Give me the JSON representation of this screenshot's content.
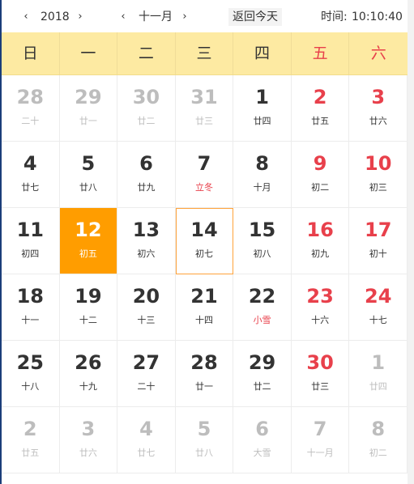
{
  "header": {
    "prev_year": "‹",
    "year": "2018",
    "next_year": "›",
    "prev_month": "‹",
    "month": "十一月",
    "next_month": "›",
    "today_label": "返回今天",
    "time_label": "时间:",
    "time_value": "10:10:40"
  },
  "weekdays": [
    "日",
    "一",
    "二",
    "三",
    "四",
    "五",
    "六"
  ],
  "colors": {
    "weekday_bar": "#fdeaa2",
    "weekend": "#e8404b",
    "today_bg": "#ff9d00",
    "selected_border": "#ffa33a",
    "other_month": "#bdbdbd"
  },
  "rows": [
    [
      {
        "day": "28",
        "lunar": "二十",
        "other": true
      },
      {
        "day": "29",
        "lunar": "廿一",
        "other": true
      },
      {
        "day": "30",
        "lunar": "廿二",
        "other": true
      },
      {
        "day": "31",
        "lunar": "廿三",
        "other": true
      },
      {
        "day": "1",
        "lunar": "廿四"
      },
      {
        "day": "2",
        "lunar": "廿五",
        "weekend": true
      },
      {
        "day": "3",
        "lunar": "廿六",
        "weekend": true
      }
    ],
    [
      {
        "day": "4",
        "lunar": "廿七"
      },
      {
        "day": "5",
        "lunar": "廿八"
      },
      {
        "day": "6",
        "lunar": "廿九"
      },
      {
        "day": "7",
        "lunar": "立冬",
        "term": true
      },
      {
        "day": "8",
        "lunar": "十月"
      },
      {
        "day": "9",
        "lunar": "初二",
        "weekend": true
      },
      {
        "day": "10",
        "lunar": "初三",
        "weekend": true
      }
    ],
    [
      {
        "day": "11",
        "lunar": "初四"
      },
      {
        "day": "12",
        "lunar": "初五",
        "today": true
      },
      {
        "day": "13",
        "lunar": "初六"
      },
      {
        "day": "14",
        "lunar": "初七",
        "selected": true
      },
      {
        "day": "15",
        "lunar": "初八"
      },
      {
        "day": "16",
        "lunar": "初九",
        "weekend": true
      },
      {
        "day": "17",
        "lunar": "初十",
        "weekend": true
      }
    ],
    [
      {
        "day": "18",
        "lunar": "十一"
      },
      {
        "day": "19",
        "lunar": "十二"
      },
      {
        "day": "20",
        "lunar": "十三"
      },
      {
        "day": "21",
        "lunar": "十四"
      },
      {
        "day": "22",
        "lunar": "小雪",
        "term": true
      },
      {
        "day": "23",
        "lunar": "十六",
        "weekend": true
      },
      {
        "day": "24",
        "lunar": "十七",
        "weekend": true
      }
    ],
    [
      {
        "day": "25",
        "lunar": "十八"
      },
      {
        "day": "26",
        "lunar": "十九"
      },
      {
        "day": "27",
        "lunar": "二十"
      },
      {
        "day": "28",
        "lunar": "廿一"
      },
      {
        "day": "29",
        "lunar": "廿二"
      },
      {
        "day": "30",
        "lunar": "廿三",
        "weekend": true
      },
      {
        "day": "1",
        "lunar": "廿四",
        "other": true
      }
    ],
    [
      {
        "day": "2",
        "lunar": "廿五",
        "other": true
      },
      {
        "day": "3",
        "lunar": "廿六",
        "other": true
      },
      {
        "day": "4",
        "lunar": "廿七",
        "other": true
      },
      {
        "day": "5",
        "lunar": "廿八",
        "other": true
      },
      {
        "day": "6",
        "lunar": "大雪",
        "other": true
      },
      {
        "day": "7",
        "lunar": "十一月",
        "other": true
      },
      {
        "day": "8",
        "lunar": "初二",
        "other": true
      }
    ]
  ]
}
